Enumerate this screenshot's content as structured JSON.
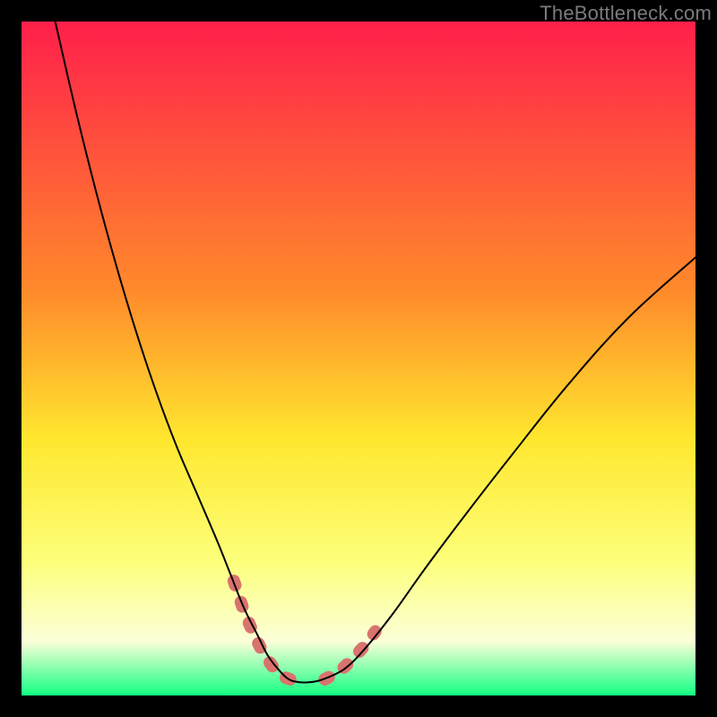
{
  "watermark": "TheBottleneck.com",
  "chart_data": {
    "type": "line",
    "title": "",
    "xlabel": "",
    "ylabel": "",
    "xlim": [
      0,
      100
    ],
    "ylim": [
      0,
      100
    ],
    "grid": false,
    "legend": false,
    "background_gradient": {
      "stops": [
        {
          "offset": 0,
          "color": "#ff1f4b"
        },
        {
          "offset": 40,
          "color": "#ff8a2b"
        },
        {
          "offset": 62,
          "color": "#ffe72e"
        },
        {
          "offset": 80,
          "color": "#fdff7a"
        },
        {
          "offset": 92,
          "color": "#fbffd8"
        },
        {
          "offset": 100,
          "color": "#12ff82"
        }
      ]
    },
    "series": [
      {
        "name": "bottleneck-curve",
        "color": "#000000",
        "stroke_width": 2,
        "x": [
          5,
          8,
          11,
          14,
          17,
          20,
          23,
          26,
          29,
          31,
          33,
          35,
          36.5,
          38,
          39.5,
          41,
          43,
          45,
          48,
          51,
          55,
          60,
          66,
          73,
          81,
          90,
          100
        ],
        "y": [
          100,
          87,
          75,
          64,
          54,
          45,
          37,
          30,
          23,
          18,
          13,
          9,
          6,
          4,
          2.5,
          2,
          2,
          2.5,
          4,
          7,
          12,
          19,
          27,
          36,
          46,
          56,
          65
        ]
      }
    ],
    "highlight_segments": [
      {
        "name": "valley-left-marker",
        "color": "#d9736e",
        "stroke_width": 14,
        "dash": [
          5,
          20
        ],
        "x": [
          31.5,
          33,
          34.5,
          36,
          37.5,
          39,
          40.5,
          42
        ],
        "y": [
          17,
          12.5,
          9,
          6,
          4,
          2.7,
          2.2,
          2
        ]
      },
      {
        "name": "valley-right-marker",
        "color": "#d9736e",
        "stroke_width": 14,
        "dash": [
          5,
          20
        ],
        "x": [
          45,
          46.5,
          48,
          49.5,
          51,
          52.5
        ],
        "y": [
          2.4,
          3.2,
          4.3,
          5.8,
          7.5,
          9.5
        ]
      }
    ]
  }
}
